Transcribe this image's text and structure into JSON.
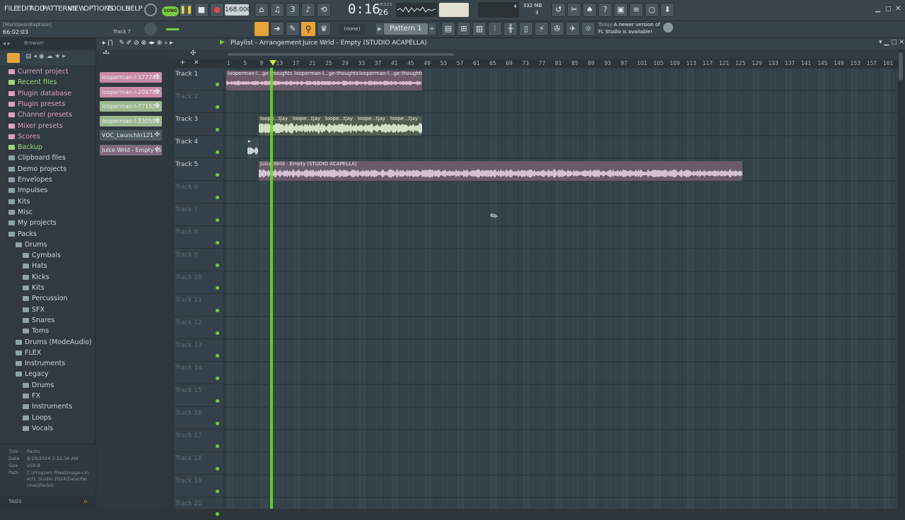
{
  "menu": [
    "FILE",
    "EDIT",
    "ADD",
    "PATTERNS",
    "VIEW",
    "OPTIONS",
    "TOOLS",
    "HELP"
  ],
  "transport": {
    "mode": "SONG",
    "tempo": "168.000",
    "time": "0:16",
    "time_sub": "26",
    "time_unit": "M:S:CS",
    "cpu": "4",
    "mem": "332 MB",
    "poly": "3"
  },
  "project": {
    "user": "[MarioJeanBaptiste]",
    "time": "66:02:03",
    "hint": "Track 7"
  },
  "pattern": {
    "none": "(none)",
    "name": "Pattern 1"
  },
  "news": {
    "day": "Today",
    "msg1": "A newer version of",
    "msg2": "FL Studio is available!"
  },
  "breadcrumb": "Playlist - Arrangement",
  "breadcrumb_song": "Juice Wrld - Empty (STUDIO ACAPELLA)",
  "browser": {
    "title": "Browser",
    "items": [
      {
        "label": "Current project",
        "color": "#d9a1c2",
        "depth": 0
      },
      {
        "label": "Recent files",
        "color": "#9fd37a",
        "depth": 0
      },
      {
        "label": "Plugin database",
        "color": "#d9a1c2",
        "depth": 0
      },
      {
        "label": "Plugin presets",
        "color": "#d9a1c2",
        "depth": 0
      },
      {
        "label": "Channel presets",
        "color": "#d9a1c2",
        "depth": 0
      },
      {
        "label": "Mixer presets",
        "color": "#d9a1c2",
        "depth": 0
      },
      {
        "label": "Scores",
        "color": "#d9a1c2",
        "depth": 0
      },
      {
        "label": "Backup",
        "color": "#9fd37a",
        "depth": 0
      },
      {
        "label": "Clipboard files",
        "color": "#8fa3ad",
        "depth": 0
      },
      {
        "label": "Demo projects",
        "color": "#8fa3ad",
        "depth": 0
      },
      {
        "label": "Envelopes",
        "color": "#8fa3ad",
        "depth": 0
      },
      {
        "label": "Impulses",
        "color": "#8fa3ad",
        "depth": 0
      },
      {
        "label": "Kits",
        "color": "#8fa3ad",
        "depth": 0
      },
      {
        "label": "Misc",
        "color": "#8fa3ad",
        "depth": 0
      },
      {
        "label": "My projects",
        "color": "#8fa3ad",
        "depth": 0
      },
      {
        "label": "Packs",
        "color": "#8fa3ad",
        "depth": 0
      },
      {
        "label": "Drums",
        "color": "#8fa3ad",
        "depth": 1
      },
      {
        "label": "Cymbals",
        "color": "#8fa3ad",
        "depth": 2
      },
      {
        "label": "Hats",
        "color": "#8fa3ad",
        "depth": 2
      },
      {
        "label": "Kicks",
        "color": "#8fa3ad",
        "depth": 2
      },
      {
        "label": "Kits",
        "color": "#8fa3ad",
        "depth": 2
      },
      {
        "label": "Percussion",
        "color": "#8fa3ad",
        "depth": 2
      },
      {
        "label": "SFX",
        "color": "#8fa3ad",
        "depth": 2
      },
      {
        "label": "Snares",
        "color": "#8fa3ad",
        "depth": 2
      },
      {
        "label": "Toms",
        "color": "#8fa3ad",
        "depth": 2
      },
      {
        "label": "Drums (ModeAudio)",
        "color": "#8fa3ad",
        "depth": 1
      },
      {
        "label": "FLEX",
        "color": "#8fa3ad",
        "depth": 1
      },
      {
        "label": "Instruments",
        "color": "#8fa3ad",
        "depth": 1
      },
      {
        "label": "Legacy",
        "color": "#8fa3ad",
        "depth": 1
      },
      {
        "label": "Drums",
        "color": "#8fa3ad",
        "depth": 2
      },
      {
        "label": "FX",
        "color": "#8fa3ad",
        "depth": 2
      },
      {
        "label": "Instruments",
        "color": "#8fa3ad",
        "depth": 2
      },
      {
        "label": "Loops",
        "color": "#8fa3ad",
        "depth": 2
      },
      {
        "label": "Vocals",
        "color": "#8fa3ad",
        "depth": 2
      }
    ],
    "info": {
      "title_k": "Title",
      "title_v": "Packs",
      "date_k": "Date",
      "date_v": "8/19/2024 2:22:36 AM",
      "size_k": "Size",
      "size_v": "259 B",
      "path_k": "Path",
      "path_v1": "C:\\Program Files\\Image-Lin",
      "path_v2": "e\\FL Studio 2024\\Data\\Pat",
      "path_v3": "ches\\Packs\\"
    },
    "tags": "TAGS"
  },
  "channels": [
    {
      "label": "looperman-l-377743...",
      "color": "#c98aa6"
    },
    {
      "label": "looperman-l-209765...",
      "color": "#c98aa6"
    },
    {
      "label": "looperman-l-771538...",
      "color": "#9cb88f"
    },
    {
      "label": "looperman-l-330599...",
      "color": "#9cb88f"
    },
    {
      "label": "VOC_LaunchIn121",
      "color": "#4d5b63"
    },
    {
      "label": "Juice Wrld - Empty (S...",
      "color": "#7f6a80"
    }
  ],
  "tracks": [
    "Track 1",
    "Track 2",
    "Track 3",
    "Track 4",
    "Track 5",
    "Track 6",
    "Track 7",
    "Track 8",
    "Track 9",
    "Track 10",
    "Track 11",
    "Track 12",
    "Track 13",
    "Track 14",
    "Track 15",
    "Track 16",
    "Track 17",
    "Track 18",
    "Track 19",
    "Track 20"
  ],
  "ruler": [
    "1",
    "5",
    "9",
    "13",
    "17",
    "21",
    "25",
    "29",
    "33",
    "37",
    "41",
    "45",
    "49",
    "53",
    "57",
    "61",
    "65",
    "69",
    "73",
    "77",
    "81",
    "85",
    "89",
    "93",
    "97",
    "101",
    "105",
    "109",
    "113",
    "117",
    "121",
    "125",
    "129",
    "133",
    "137",
    "141",
    "145",
    "149",
    "153",
    "157",
    "161"
  ],
  "clips": {
    "t1_a": "looperman-l...ge-thoughts",
    "t1_b": "looperman-l...ge-thoughts",
    "t1_c": "looperman-l...ge-thoughts",
    "t3_a": "loope...tjay",
    "t3_b": "loope...tjay",
    "t3_c": "loope...tjay",
    "t3_d": "loope...tjay",
    "t3_e": "loope...tjay",
    "t5": "Juice Wrld - Empty (STUDIO ACAPELLA)"
  },
  "colors": {
    "accent": "#7ac943",
    "pink": "#c9a6bf",
    "green_clip": "#a7c19a",
    "playhead": "#71d13a"
  }
}
